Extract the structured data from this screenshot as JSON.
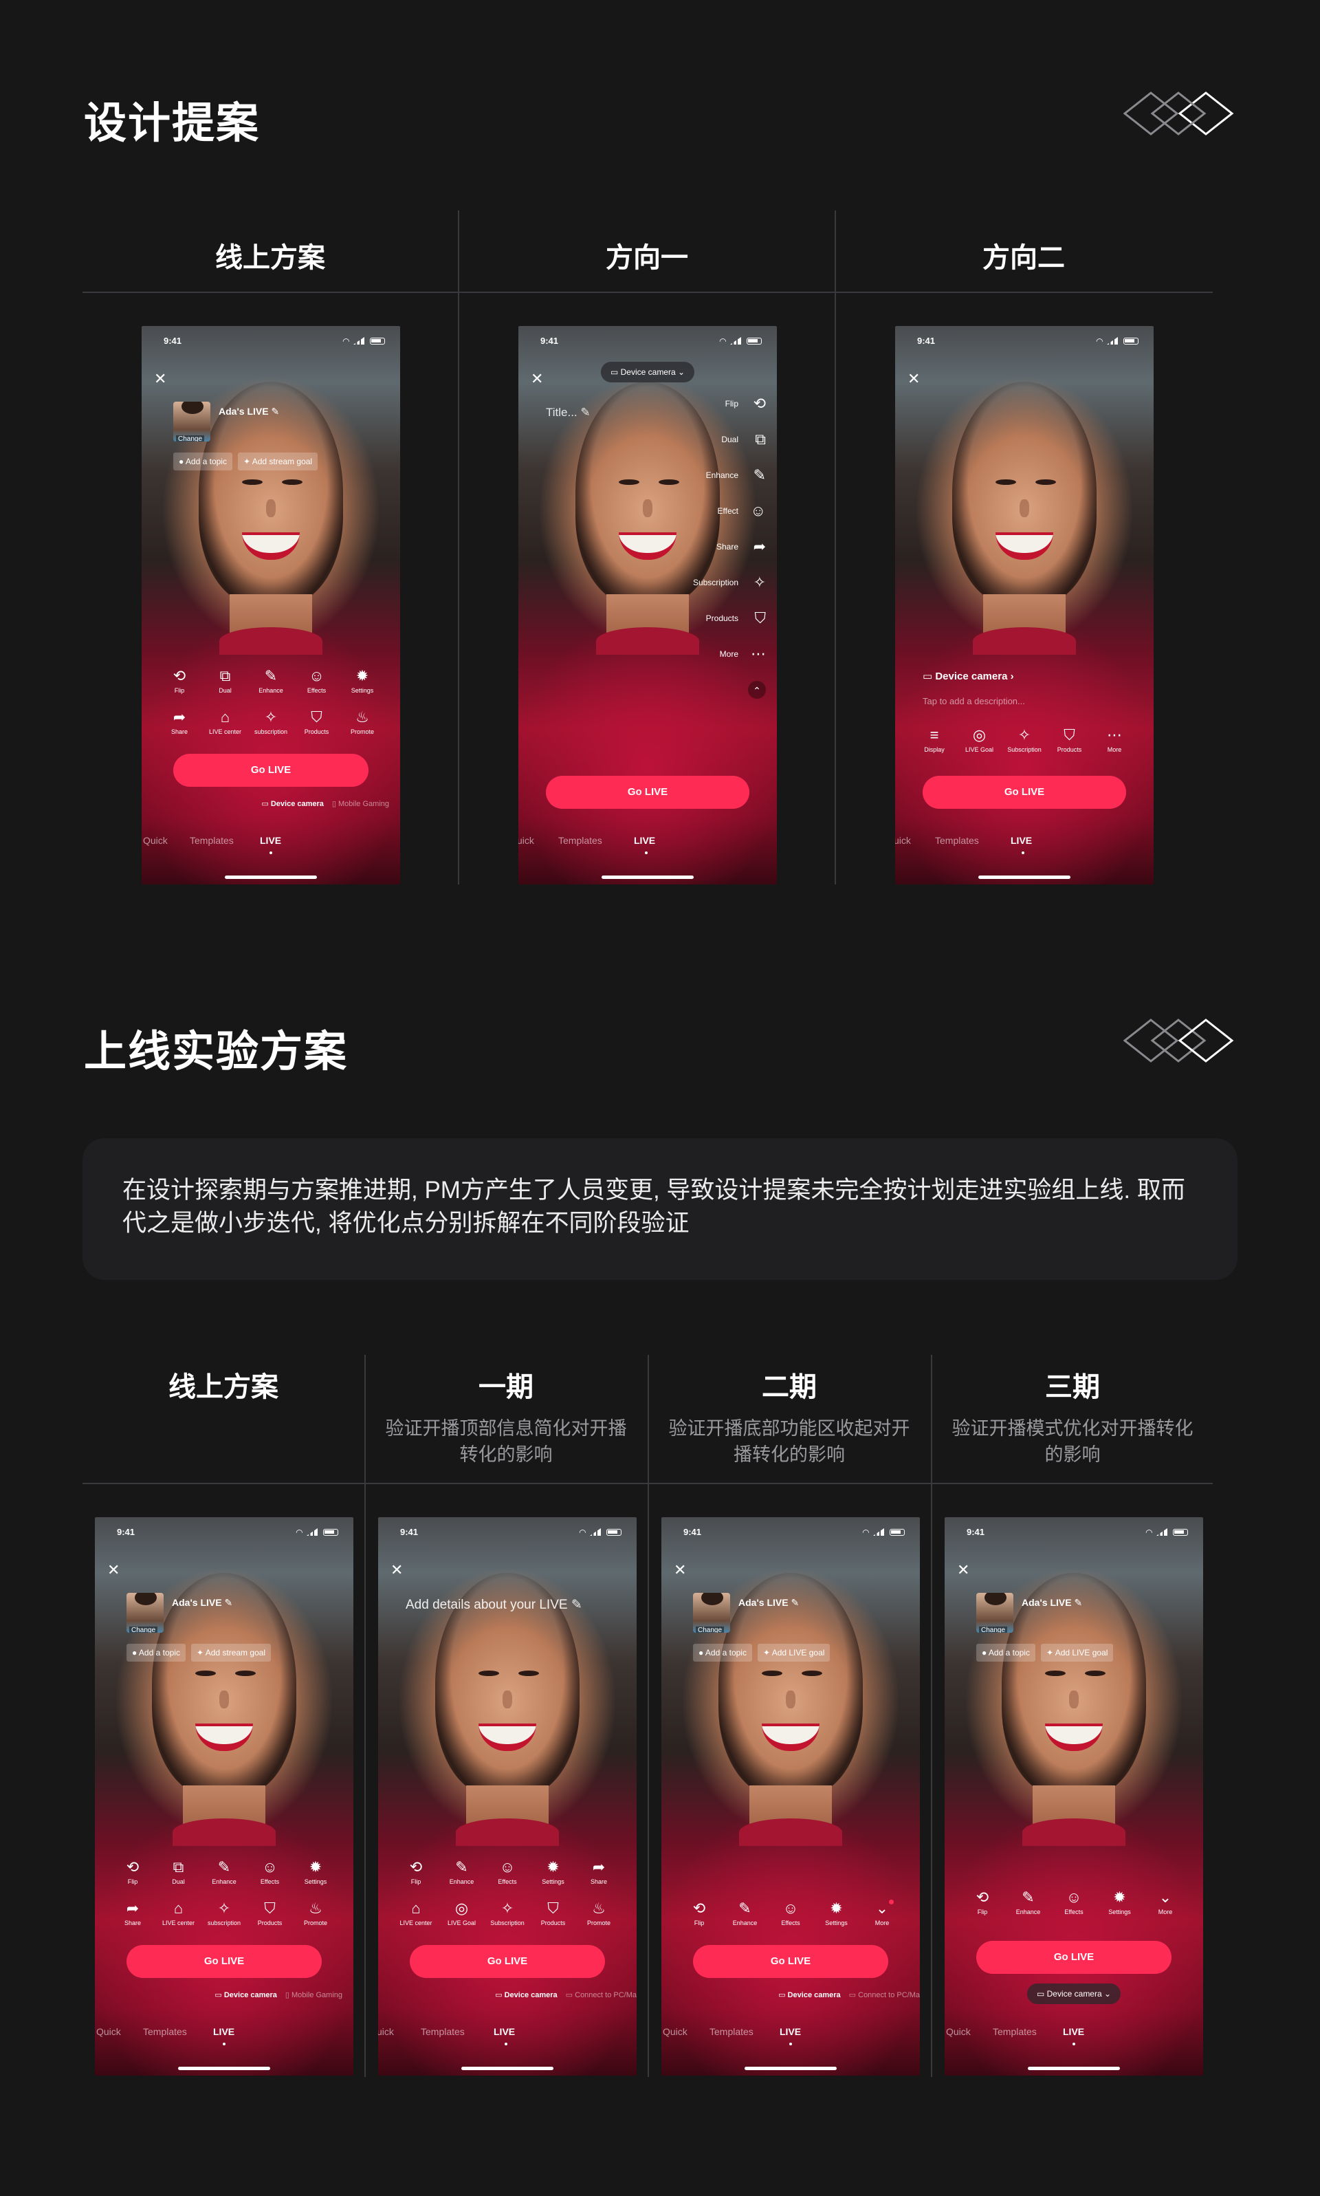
{
  "section1": {
    "title": "设计提案"
  },
  "section2": {
    "title": "上线实验方案"
  },
  "note": "在设计探索期与方案推进期, PM方产生了人员变更, 导致设计提案未完全按计划走进实验组上线. 取而代之是做小步迭代, 将优化点分别拆解在不同阶段验证",
  "cols1": [
    {
      "title": "线上方案"
    },
    {
      "title": "方向一"
    },
    {
      "title": "方向二"
    }
  ],
  "cols2": [
    {
      "title": "线上方案",
      "sub": ""
    },
    {
      "title": "一期",
      "sub": "验证开播顶部信息简化对开播转化的影响"
    },
    {
      "title": "二期",
      "sub": "验证开播底部功能区收起对开播转化的影响"
    },
    {
      "title": "三期",
      "sub": "验证开播模式优化对开播转化的影响"
    }
  ],
  "phone": {
    "time": "9:41",
    "close": "✕",
    "go_live": "Go LIVE",
    "live_name": "Ada's LIVE ✎",
    "change": "Change",
    "tabs": {
      "quick": "Quick",
      "quick_cut": "uick",
      "templates": "Templates",
      "live": "LIVE"
    },
    "chips": {
      "topic": "● Add a topic",
      "stream_goal": "✦ Add stream goal",
      "live_goal": "✦ Add LIVE goal"
    },
    "device_camera": "▭ Device camera",
    "mobile_gaming": "▯ Mobile Gaming",
    "connect_pc": "▭ Connect to PC/Ma",
    "device_camera_pill": "▭ Device camera ⌄",
    "title_ph": "Title... ✎",
    "dir2_device": "▭ Device camera  ›",
    "dir2_desc": "Tap to add a description...",
    "p1_title": "Add details about your LIVE ✎",
    "tools": {
      "flip": "Flip",
      "dual": "Dual",
      "enhance": "Enhance",
      "effects": "Effects",
      "effect": "Effect",
      "settings": "Settings",
      "share": "Share",
      "live_center": "LIVE center",
      "subscription": "subscription",
      "Subscription": "Subscription",
      "products": "Products",
      "promote": "Promote",
      "more": "More",
      "display": "Display",
      "live_goal": "LIVE Goal"
    }
  },
  "icons": {
    "flip": "⟲",
    "dual": "⧉",
    "enhance": "✎",
    "effects": "☺",
    "settings": "✹",
    "share": "➦",
    "live_center": "⌂",
    "subscription": "✧",
    "products": "⛉",
    "promote": "♨",
    "more": "⋯",
    "more_circle": "⌄",
    "display": "≡",
    "goal": "◎",
    "collapse": "⌃"
  }
}
